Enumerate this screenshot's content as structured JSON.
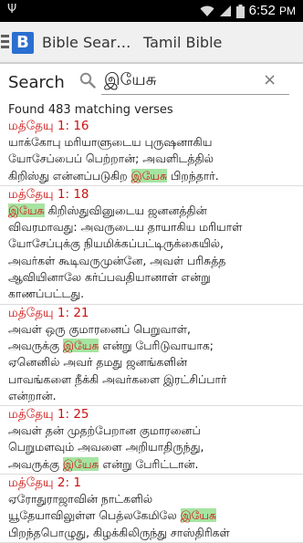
{
  "status_bar": {
    "time": "6:52",
    "ampm": "PM",
    "icons": [
      "usb-icon",
      "wifi-icon",
      "signal-icon",
      "battery-icon"
    ]
  },
  "action_bar": {
    "app_title": "Bible Sear…",
    "tab_title": "Tamil Bible",
    "app_icon_letter": "B"
  },
  "search": {
    "label": "Search",
    "query": "இயேசு",
    "clear_symbol": "×"
  },
  "results": {
    "count_text": "Found 483 matching verses",
    "highlight_color": "#a6e4a1",
    "reference_color": "#cc1111",
    "verses": [
      {
        "ref": "மத்தேயு 1: 16",
        "lines": [
          [
            "யாக்கோபு மரியாளுடைய புருஷனாகிய"
          ],
          [
            "யோசேப்பைப் பெற்றான்; அவளிடத்தில்"
          ],
          [
            "கிறிஸ்து என்னப்படுகிற ",
            "இயேசு",
            " பிறந்தார்."
          ]
        ]
      },
      {
        "ref": "மத்தேயு 1: 18",
        "lines": [
          [
            "",
            "இயேசு",
            " கிறிஸ்துவினுடைய ஜனனத்தின்"
          ],
          [
            "விவரமாவது: அவருடைய தாயாகிய மரியாள்"
          ],
          [
            "யோசேப்புக்கு நியமிக்கப்பட்டிருக்கையில்,"
          ],
          [
            "அவர்கள் கூடிவருமுன்னே, அவள் பரிசுத்த"
          ],
          [
            "ஆவியினாலே கர்ப்பவதியானாள் என்று"
          ],
          [
            "காணப்பட்டது."
          ]
        ]
      },
      {
        "ref": "மத்தேயு 1: 21",
        "lines": [
          [
            "அவள் ஒரு குமாரனைப் பெறுவாள்,"
          ],
          [
            "அவருக்கு ",
            "இயேசு",
            " என்று பேரிடுவாயாக;"
          ],
          [
            "ஏனெனில் அவர் தமது ஜனங்களின்"
          ],
          [
            "பாவங்களை நீக்கி அவர்களை இரட்சிப்பார்"
          ],
          [
            "என்றான்."
          ]
        ]
      },
      {
        "ref": "மத்தேயு 1: 25",
        "lines": [
          [
            "அவள் தன் முதற்பேறான குமாரனைப்"
          ],
          [
            "பெறுமளவும் அவளை அறியாதிருந்து,"
          ],
          [
            "அவருக்கு ",
            "இயேசு",
            " என்று பேரிட்டான்."
          ]
        ]
      },
      {
        "ref": "மத்தேயு 2: 1",
        "lines": [
          [
            "ஏரோதுராஜாவின் நாட்களில்"
          ],
          [
            "யூதேயாவிலுள்ள பெத்லகேமிலே ",
            "இயேசு",
            ""
          ],
          [
            "பிறந்தபொழுது, கிழக்கிலிருந்து சாஸ்திரிகள்"
          ]
        ]
      }
    ]
  }
}
